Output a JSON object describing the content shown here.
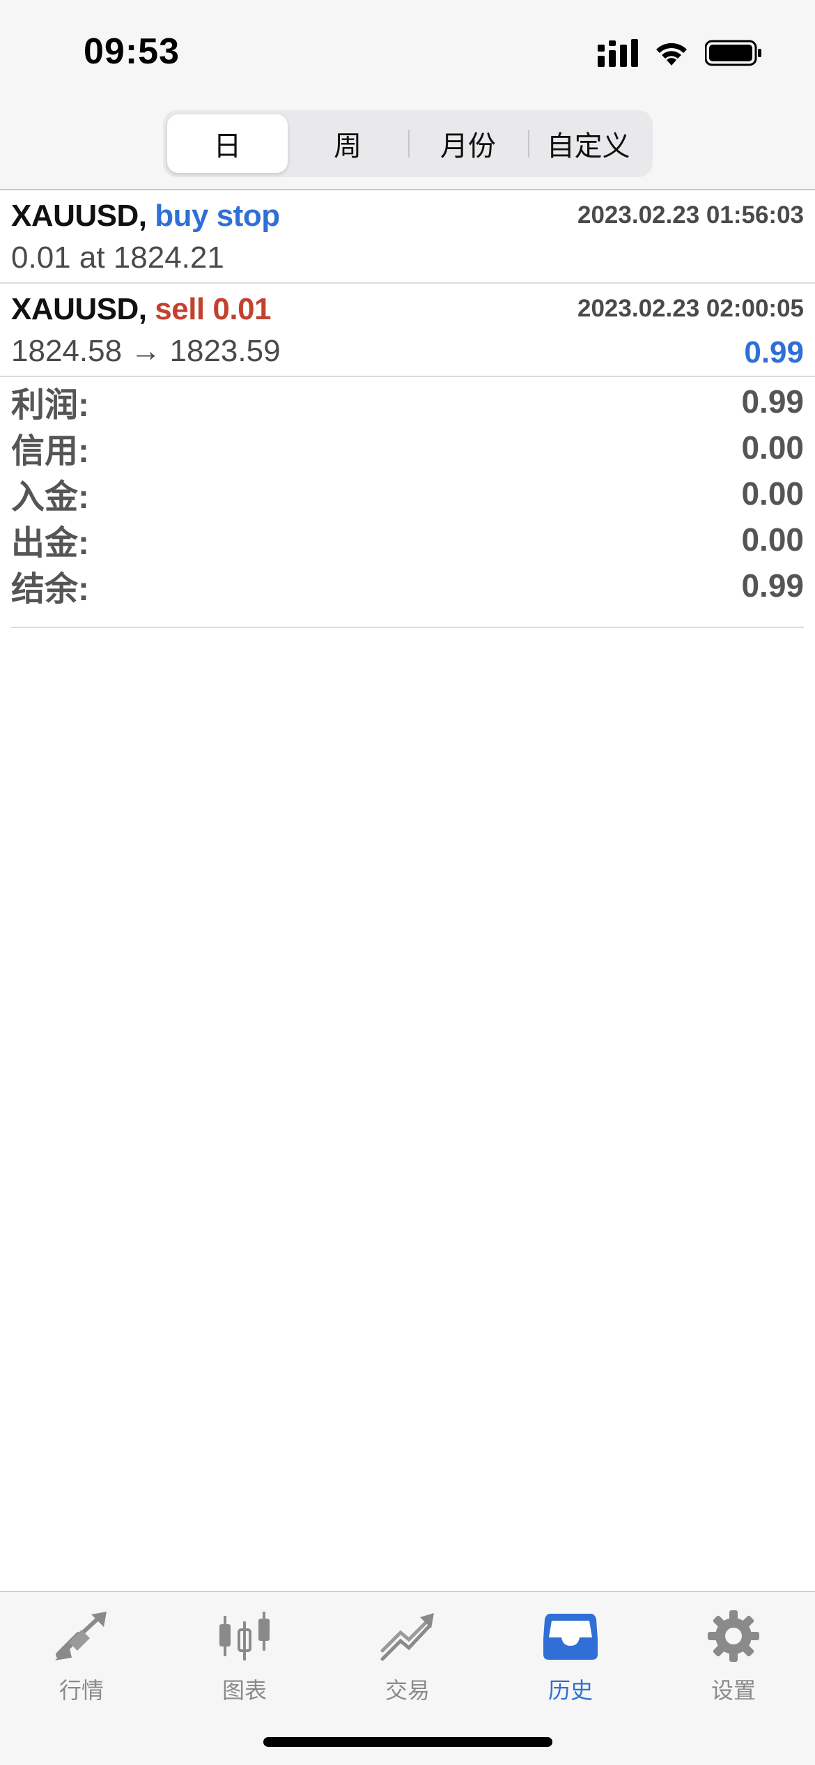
{
  "status_bar": {
    "time": "09:53"
  },
  "segments": [
    {
      "label": "日",
      "active": true
    },
    {
      "label": "周",
      "active": false
    },
    {
      "label": "月份",
      "active": false
    },
    {
      "label": "自定义",
      "active": false
    }
  ],
  "history": [
    {
      "symbol": "XAUUSD,",
      "type": "buy stop",
      "datetime": "2023.02.23 01:56:03",
      "detail": "0.01 at 1824.21",
      "profit": ""
    },
    {
      "symbol": "XAUUSD,",
      "type": "sell 0.01",
      "datetime": "2023.02.23 02:00:05",
      "detail": "1824.58 → 1823.59",
      "profit": "0.99"
    }
  ],
  "summary": {
    "profit": {
      "label": "利润:",
      "value": "0.99"
    },
    "credit": {
      "label": "信用:",
      "value": "0.00"
    },
    "deposit": {
      "label": "入金:",
      "value": "0.00"
    },
    "withdrawal": {
      "label": "出金:",
      "value": "0.00"
    },
    "balance": {
      "label": "结余:",
      "value": "0.99"
    }
  },
  "tabbar": [
    {
      "label": "行情",
      "icon": "quotes-arrows-icon",
      "active": false
    },
    {
      "label": "图表",
      "icon": "candlestick-chart-icon",
      "active": false
    },
    {
      "label": "交易",
      "icon": "trade-trend-icon",
      "active": false
    },
    {
      "label": "历史",
      "icon": "history-inbox-icon",
      "active": true
    },
    {
      "label": "设置",
      "icon": "gear-icon",
      "active": false
    }
  ],
  "colors": {
    "accent_blue": "#2f6fd6",
    "sell_red": "#c3412f",
    "inactive_gray": "#8a8a8a"
  }
}
